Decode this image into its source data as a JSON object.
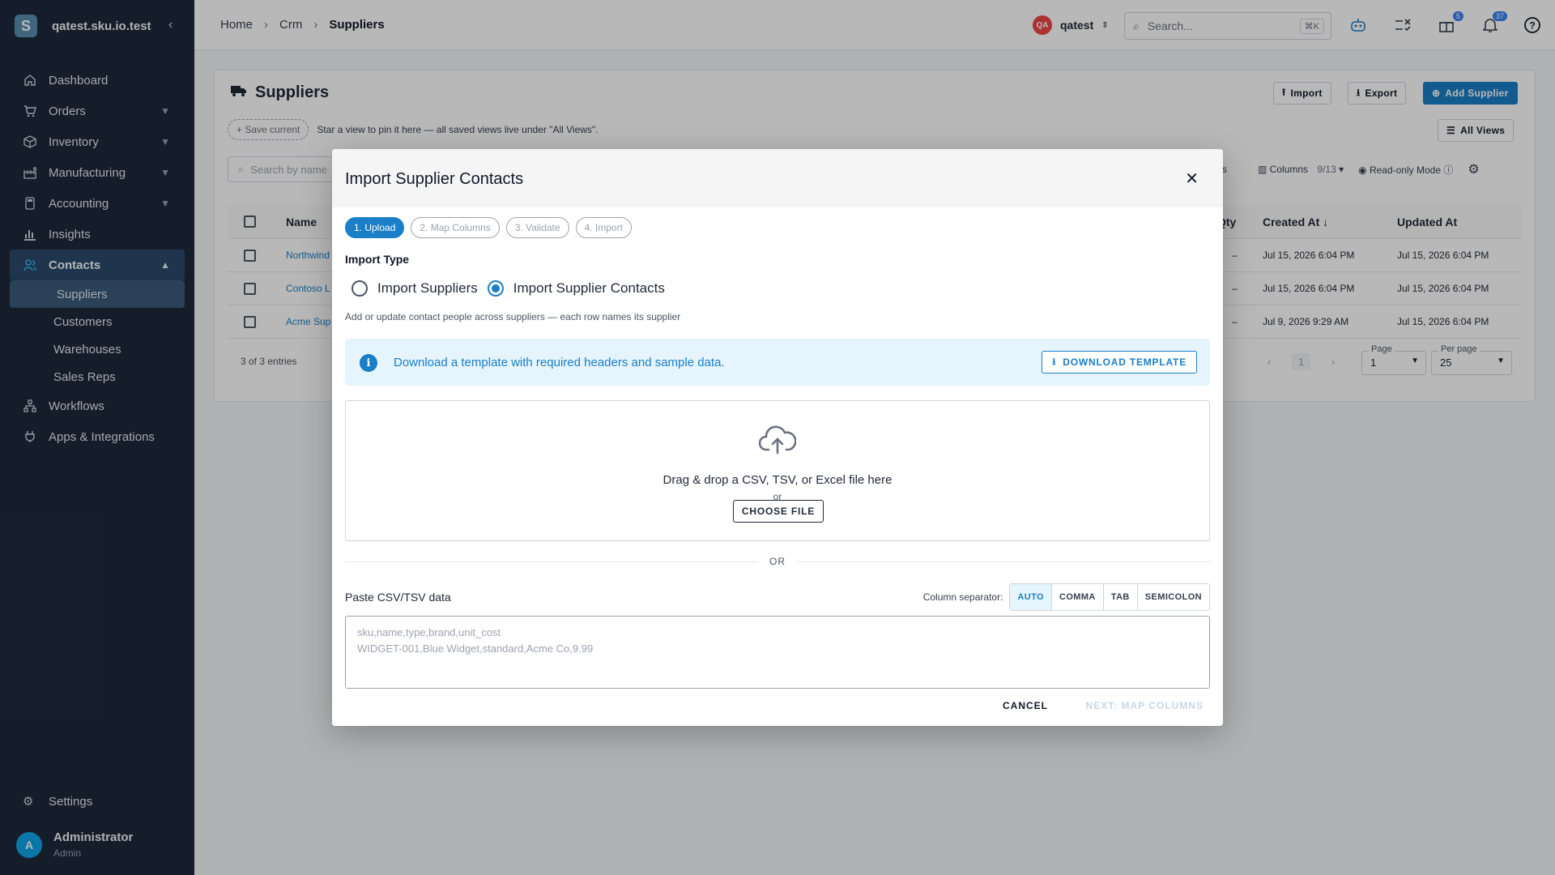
{
  "sidebar": {
    "brand": "qatest.sku.io.test",
    "logo_letter": "S",
    "items": [
      {
        "label": "Dashboard"
      },
      {
        "label": "Orders"
      },
      {
        "label": "Inventory"
      },
      {
        "label": "Manufacturing"
      },
      {
        "label": "Accounting"
      },
      {
        "label": "Insights"
      },
      {
        "label": "Contacts"
      },
      {
        "label": "Workflows"
      },
      {
        "label": "Apps & Integrations"
      }
    ],
    "contacts_sub": [
      {
        "label": "Suppliers"
      },
      {
        "label": "Customers"
      },
      {
        "label": "Warehouses"
      },
      {
        "label": "Sales Reps"
      }
    ],
    "settings": "Settings",
    "user": {
      "initial": "A",
      "name": "Administrator",
      "role": "Admin"
    }
  },
  "topbar": {
    "breadcrumbs": [
      "Home",
      "Crm",
      "Suppliers"
    ],
    "account_initials": "QA",
    "account_name": "qatest",
    "search_placeholder": "Search...",
    "search_shortcut": "⌘K",
    "gift_badge": "5",
    "notif_badge": "37"
  },
  "page": {
    "title": "Suppliers",
    "import": "Import",
    "export": "Export",
    "add_supplier": "Add Supplier",
    "save_current": "Save current",
    "views_hint": "Star a view to pin it here — all saved views live under \"All Views\".",
    "all_views": "All Views",
    "search_placeholder": "Search by name",
    "filters": "ters",
    "columns": "Columns",
    "columns_count": "9/13",
    "readonly": "Read-only Mode",
    "headers": {
      "name": "Name",
      "qty": "Qty",
      "created": "Created At",
      "updated": "Updated At"
    },
    "rows": [
      {
        "name": "Northwind",
        "qty": "–",
        "created": "Jul 15, 2026 6:04 PM",
        "updated": "Jul 15, 2026 6:04 PM"
      },
      {
        "name": "Contoso L",
        "qty": "–",
        "created": "Jul 15, 2026 6:04 PM",
        "updated": "Jul 15, 2026 6:04 PM"
      },
      {
        "name": "Acme Sup",
        "qty": "–",
        "created": "Jul 9, 2026 9:29 AM",
        "updated": "Jul 15, 2026 6:04 PM"
      }
    ],
    "entries": "3 of 3 entries",
    "page_num": "1",
    "page_label": "Page",
    "page_value": "1",
    "per_page_label": "Per page",
    "per_page_value": "25"
  },
  "modal": {
    "title": "Import Supplier Contacts",
    "steps": [
      "1. Upload",
      "2. Map Columns",
      "3. Validate",
      "4. Import"
    ],
    "import_type_label": "Import Type",
    "option_suppliers": "Import Suppliers",
    "option_contacts": "Import Supplier Contacts",
    "helper": "Add or update contact people across suppliers — each row names its supplier",
    "info_text": "Download a template with required headers and sample data.",
    "download_template": "DOWNLOAD TEMPLATE",
    "drop_text": "Drag & drop a CSV, TSV, or Excel file here",
    "or_small": "or",
    "choose_file": "CHOOSE FILE",
    "or_divider": "OR",
    "paste_label": "Paste CSV/TSV data",
    "separator_label": "Column separator:",
    "separators": [
      "AUTO",
      "COMMA",
      "TAB",
      "SEMICOLON"
    ],
    "placeholder_line1": "sku,name,type,brand,unit_cost",
    "placeholder_line2": "WIDGET-001,Blue Widget,standard,Acme Co,9.99",
    "cancel": "CANCEL",
    "next": "NEXT: MAP COLUMNS"
  },
  "colors": {
    "accent": "#1a7fc7",
    "sidebar": "#1e293b"
  }
}
